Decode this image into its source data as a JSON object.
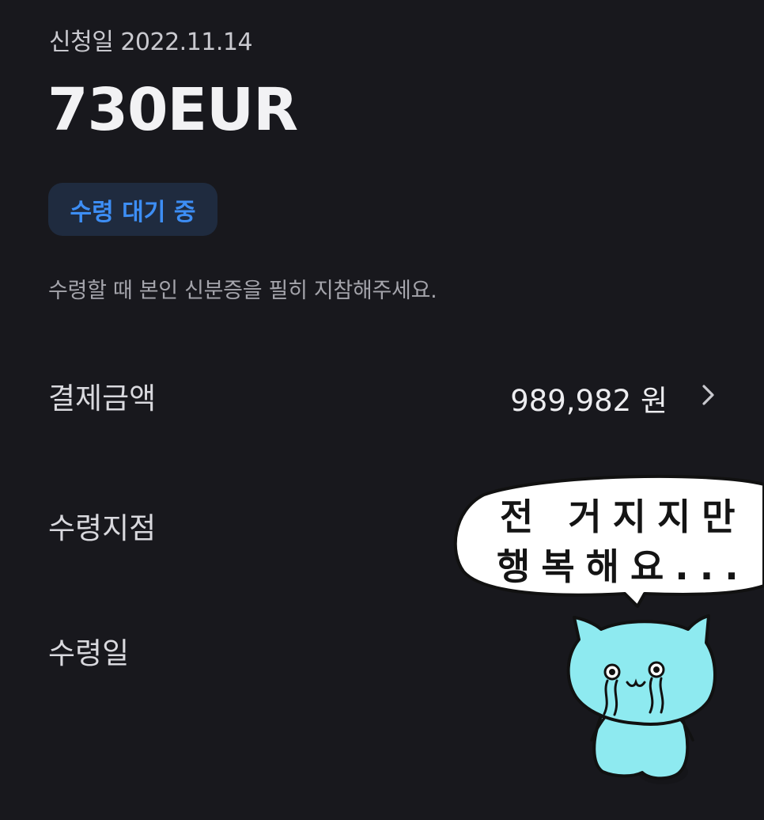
{
  "header": {
    "apply_date": "신청일 2022.11.14",
    "amount": "730EUR"
  },
  "status": {
    "label": "수령 대기 중",
    "color": "#3d8ef5"
  },
  "notice": "수령할 때 본인 신분증을 필히 지참해주세요.",
  "details": {
    "payment_label": "결제금액",
    "payment_value": "989,982 원",
    "branch_label": "수령지점",
    "date_label": "수령일"
  },
  "sticker": {
    "line1": "전 거지지만",
    "line2": "행복해요...",
    "character_color": "#8eeaf0"
  }
}
